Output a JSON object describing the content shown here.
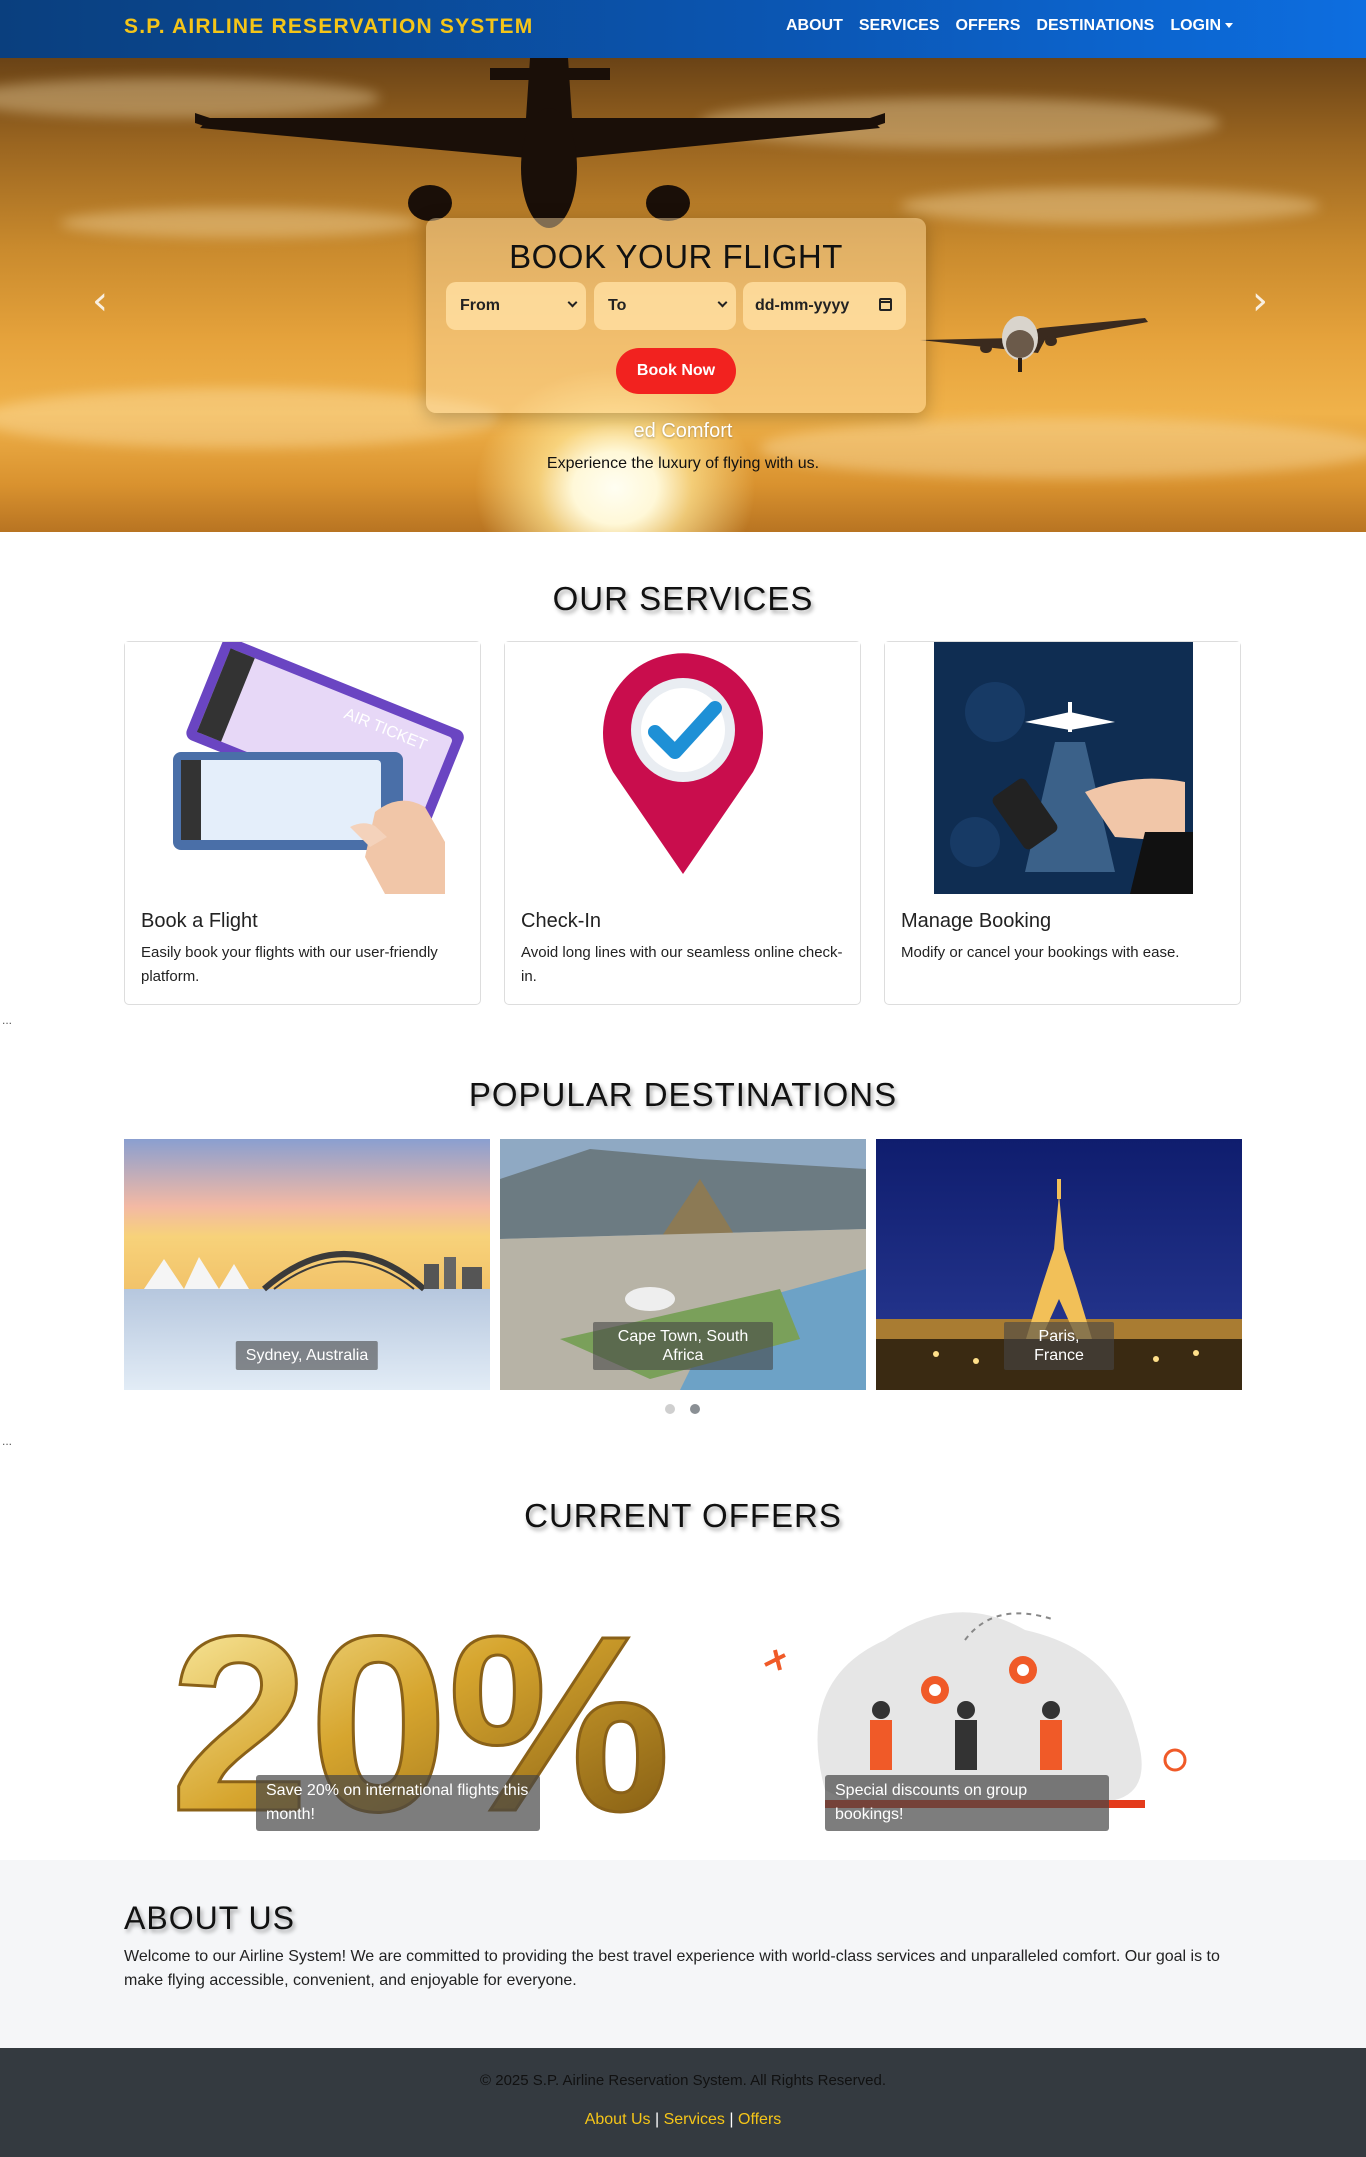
{
  "navbar": {
    "brand": "S.P. AIRLINE RESERVATION SYSTEM",
    "links": [
      "ABOUT",
      "SERVICES",
      "OFFERS",
      "DESTINATIONS"
    ],
    "login": "LOGIN"
  },
  "hero": {
    "booking_title": "BOOK YOUR FLIGHT",
    "from_label": "From",
    "to_label": "To",
    "date_placeholder": "dd-mm-yyyy",
    "book_button": "Book Now",
    "caption_title": "ed Comfort",
    "caption_text": "Experience the luxury of flying with us."
  },
  "services": {
    "title": "OUR SERVICES",
    "cards": [
      {
        "title": "Book a Flight",
        "text": "Easily book your flights with our user-friendly platform."
      },
      {
        "title": "Check-In",
        "text": "Avoid long lines with our seamless online check-in."
      },
      {
        "title": "Manage Booking",
        "text": "Modify or cancel your bookings with ease."
      }
    ],
    "ticket_text": "AIR TICKET"
  },
  "separator": "...",
  "destinations": {
    "title": "POPULAR DESTINATIONS",
    "items": [
      "Sydney, Australia",
      "Cape Town, South Africa",
      "Paris, France"
    ]
  },
  "offers": {
    "title": "CURRENT OFFERS",
    "items": [
      "Save 20% on international flights this month!",
      "Special discounts on group bookings!"
    ],
    "big_number": "20%"
  },
  "about": {
    "title": "ABOUT US",
    "text": "Welcome to our Airline System! We are committed to providing the best travel experience with world-class services and unparalleled comfort. Our goal is to make flying accessible, convenient, and enjoyable for everyone."
  },
  "footer": {
    "copyright": "© 2025 S.P. Airline Reservation System. All Rights Reserved.",
    "links": [
      "About Us",
      "Services",
      "Offers"
    ],
    "sep": "|"
  }
}
